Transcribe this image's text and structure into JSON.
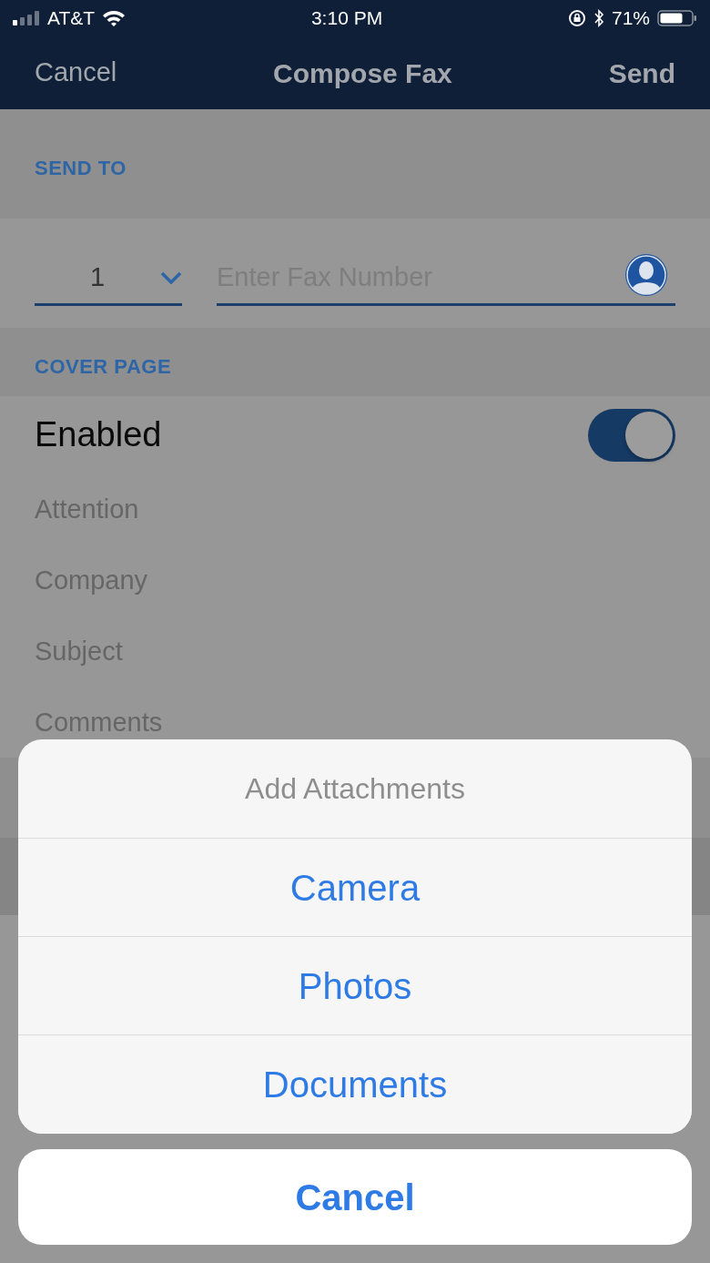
{
  "status_bar": {
    "carrier": "AT&T",
    "time": "3:10 PM",
    "battery": "71%"
  },
  "nav": {
    "left": "Cancel",
    "title": "Compose Fax",
    "right": "Send"
  },
  "send_to": {
    "header": "SEND TO",
    "country_code": "1",
    "fax_number": {
      "placeholder": "Enter Fax Number"
    }
  },
  "cover_page": {
    "header": "COVER PAGE",
    "toggle_label": "Enabled",
    "on": true,
    "fields": [
      {
        "placeholder": "Attention"
      },
      {
        "placeholder": "Company"
      },
      {
        "placeholder": "Subject"
      },
      {
        "placeholder": "Comments"
      }
    ]
  },
  "action_sheet": {
    "title": "Add Attachments",
    "options": [
      "Camera",
      "Photos",
      "Documents"
    ],
    "cancel": "Cancel"
  }
}
